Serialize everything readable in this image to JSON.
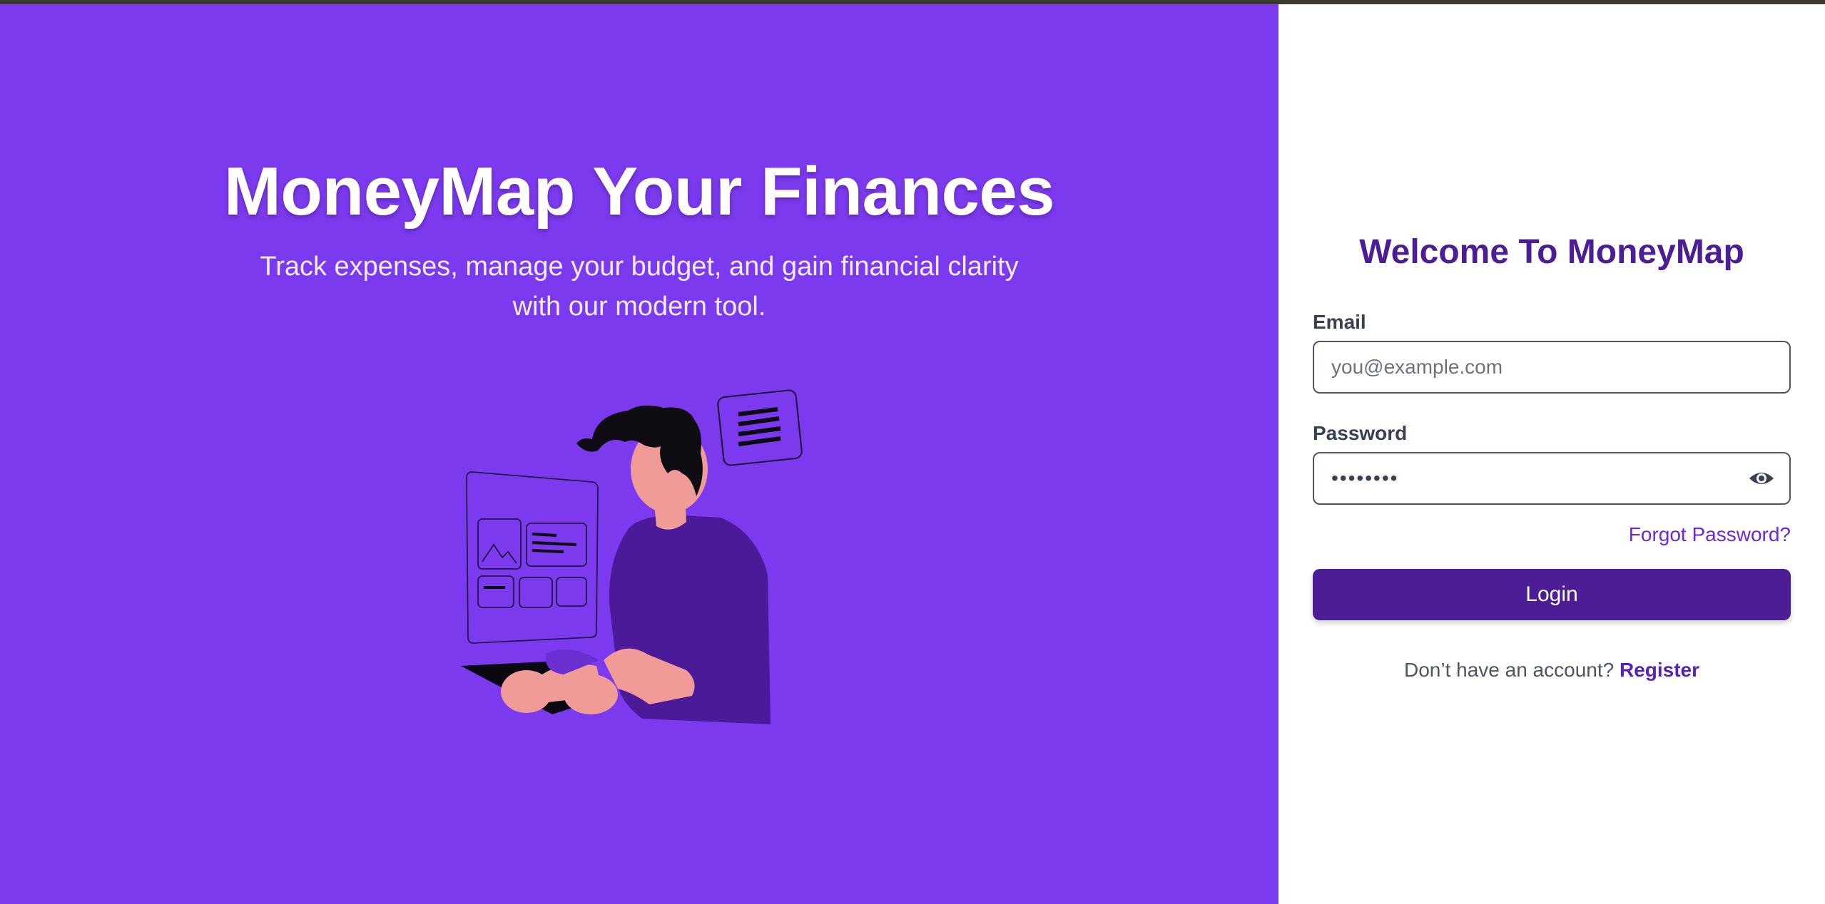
{
  "hero": {
    "title": "MoneyMap Your Finances",
    "subtitle": "Track expenses, manage your budget, and gain financial clarity with our modern tool.",
    "background_color": "#7b3aed"
  },
  "login": {
    "heading": "Welcome To MoneyMap",
    "email_label": "Email",
    "email_placeholder": "you@example.com",
    "email_value": "",
    "password_label": "Password",
    "password_value": "••••••••",
    "password_toggle_icon": "eye-icon",
    "forgot_password": "Forgot Password?",
    "submit_label": "Login",
    "register_prompt": "Don’t have an account?",
    "register_link": "Register",
    "accent_color": "#4c1d95"
  }
}
